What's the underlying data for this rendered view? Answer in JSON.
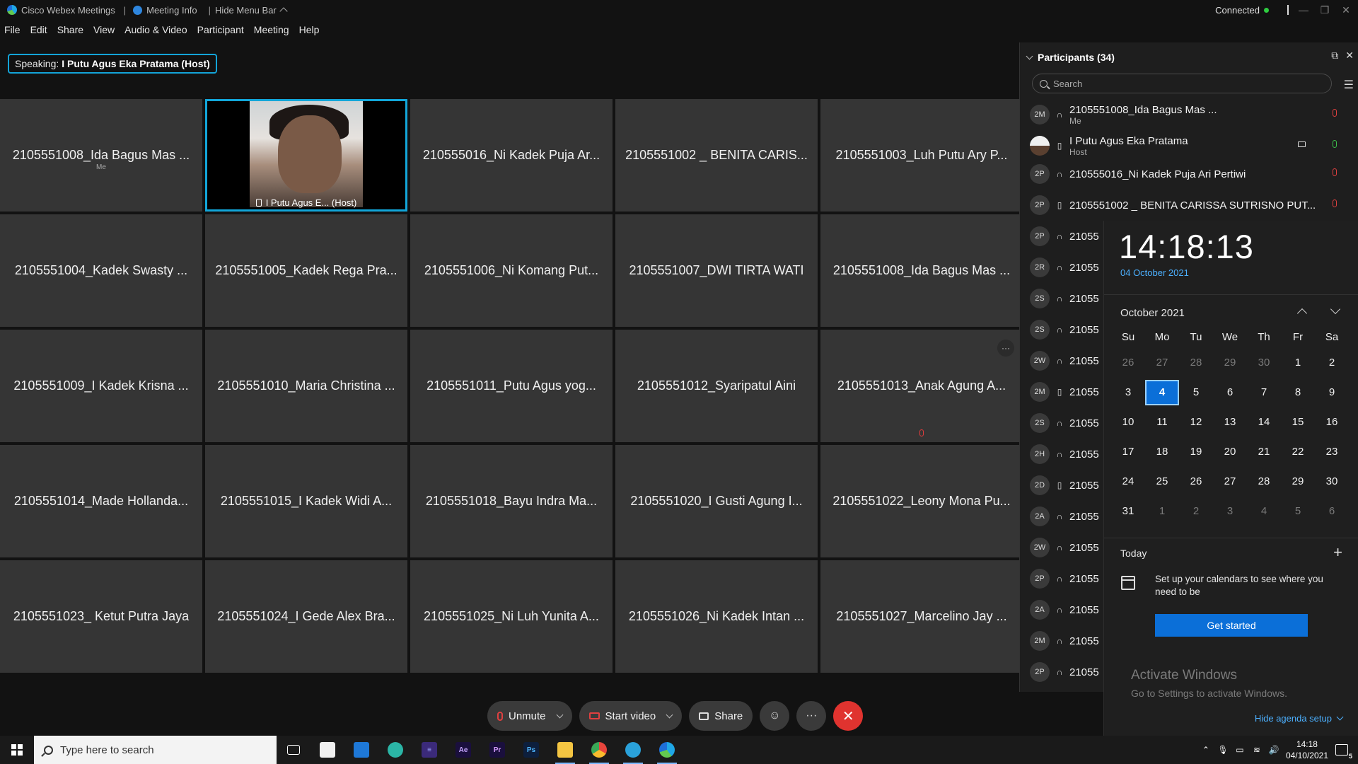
{
  "titlebar": {
    "app": "Cisco Webex Meetings",
    "meeting_info": "Meeting Info",
    "hide_menu": "Hide Menu Bar",
    "status": "Connected"
  },
  "menu": [
    "File",
    "Edit",
    "Share",
    "View",
    "Audio & Video",
    "Participant",
    "Meeting",
    "Help"
  ],
  "speaking": {
    "prefix": "Speaking:",
    "name": "I Putu Agus Eka Pratama (Host)"
  },
  "tiles": [
    "2105551008_Ida Bagus Mas ...",
    "I Putu Agus E... (Host)",
    "210555016_Ni Kadek Puja Ar...",
    "2105551002 _ BENITA CARIS...",
    "2105551003_Luh Putu Ary P...",
    "2105551004_Kadek Swasty ...",
    "2105551005_Kadek Rega Pra...",
    "2105551006_Ni Komang Put...",
    "2105551007_DWI TIRTA WATI",
    "2105551008_Ida Bagus Mas ...",
    "2105551009_I Kadek Krisna ...",
    "2105551010_Maria Christina ...",
    "2105551011_Putu Agus yog...",
    "2105551012_Syaripatul Aini",
    "2105551013_Anak Agung A...",
    "2105551014_Made Hollanda...",
    "2105551015_I Kadek Widi A...",
    "2105551018_Bayu Indra Ma...",
    "2105551020_I Gusti Agung I...",
    "2105551022_Leony Mona Pu...",
    "2105551023_ Ketut Putra Jaya",
    "2105551024_I Gede Alex Bra...",
    "2105551025_Ni Luh Yunita A...",
    "2105551026_Ni Kadek Intan ...",
    "2105551027_Marcelino Jay ..."
  ],
  "me_label": "Me",
  "controls": {
    "unmute": "Unmute",
    "start_video": "Start video",
    "share": "Share"
  },
  "participants": {
    "title": "Participants (34)",
    "search_placeholder": "Search",
    "rows": [
      {
        "initials": "2M",
        "name": "2105551008_Ida Bagus Mas ...",
        "sub": "Me"
      },
      {
        "initials": "",
        "name": "I Putu Agus Eka Pratama",
        "sub": "Host"
      },
      {
        "initials": "2P",
        "name": "210555016_Ni Kadek Puja Ari Pertiwi",
        "sub": ""
      },
      {
        "initials": "2P",
        "name": "2105551002 _ BENITA CARISSA SUTRISNO PUT...",
        "sub": ""
      },
      {
        "initials": "2P",
        "name": "21055",
        "sub": ""
      },
      {
        "initials": "2R",
        "name": "21055",
        "sub": ""
      },
      {
        "initials": "2S",
        "name": "21055",
        "sub": ""
      },
      {
        "initials": "2S",
        "name": "21055",
        "sub": ""
      },
      {
        "initials": "2W",
        "name": "21055",
        "sub": ""
      },
      {
        "initials": "2M",
        "name": "21055",
        "sub": ""
      },
      {
        "initials": "2S",
        "name": "21055",
        "sub": ""
      },
      {
        "initials": "2H",
        "name": "21055",
        "sub": ""
      },
      {
        "initials": "2D",
        "name": "21055",
        "sub": ""
      },
      {
        "initials": "2A",
        "name": "21055",
        "sub": ""
      },
      {
        "initials": "2W",
        "name": "21055",
        "sub": ""
      },
      {
        "initials": "2P",
        "name": "21055",
        "sub": ""
      },
      {
        "initials": "2A",
        "name": "21055",
        "sub": ""
      },
      {
        "initials": "2M",
        "name": "21055",
        "sub": ""
      },
      {
        "initials": "2P",
        "name": "21055",
        "sub": ""
      }
    ]
  },
  "calendar": {
    "time": "14:18:13",
    "date": "04 October 2021",
    "month": "October 2021",
    "weekdays": [
      "Su",
      "Mo",
      "Tu",
      "We",
      "Th",
      "Fr",
      "Sa"
    ],
    "weeks": [
      [
        "26",
        "27",
        "28",
        "29",
        "30",
        "1",
        "2"
      ],
      [
        "3",
        "4",
        "5",
        "6",
        "7",
        "8",
        "9"
      ],
      [
        "10",
        "11",
        "12",
        "13",
        "14",
        "15",
        "16"
      ],
      [
        "17",
        "18",
        "19",
        "20",
        "21",
        "22",
        "23"
      ],
      [
        "24",
        "25",
        "26",
        "27",
        "28",
        "29",
        "30"
      ],
      [
        "31",
        "1",
        "2",
        "3",
        "4",
        "5",
        "6"
      ]
    ],
    "today_label": "Today",
    "setup_text": "Set up your calendars to see where you need to be",
    "get_started": "Get started",
    "activate_title": "Activate Windows",
    "activate_sub": "Go to Settings to activate Windows.",
    "hide_agenda": "Hide agenda setup"
  },
  "taskbar": {
    "search_placeholder": "Type here to search",
    "time": "14:18",
    "date": "04/10/2021",
    "notifications": "5"
  },
  "colors": {
    "accent": "#12a6d9",
    "end_call": "#e0332f",
    "calendar_blue": "#0b6fd8"
  }
}
